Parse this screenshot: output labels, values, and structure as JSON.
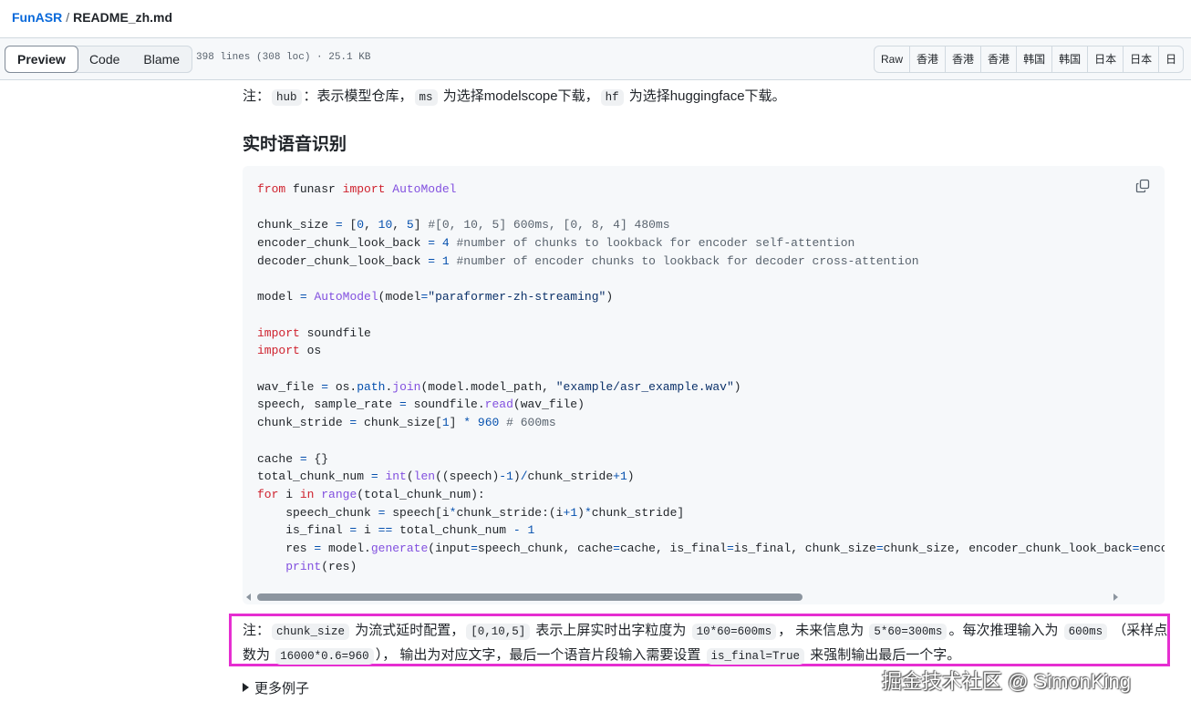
{
  "breadcrumb": {
    "repo": "FunASR",
    "separator": "/",
    "file": "README_zh.md"
  },
  "toolbar": {
    "tabs": [
      {
        "label": "Preview",
        "active": true
      },
      {
        "label": "Code",
        "active": false
      },
      {
        "label": "Blame",
        "active": false
      }
    ],
    "file_meta": "398 lines (308 loc) · 25.1 KB",
    "buttons": [
      "Raw",
      "香港",
      "香港",
      "香港",
      "韩国",
      "韩国",
      "日本",
      "日本",
      "日"
    ]
  },
  "note1": {
    "prefix": "注：",
    "hub_code": "hub",
    "text1": "：表示模型仓库，",
    "ms_code": "ms",
    "text2": " 为选择modelscope下载，",
    "hf_code": "hf",
    "text3": " 为选择huggingface下载。"
  },
  "section_title": "实时语音识别",
  "code_lines": [
    "from funasr import AutoModel",
    "",
    "chunk_size = [0, 10, 5] #[0, 10, 5] 600ms, [0, 8, 4] 480ms",
    "encoder_chunk_look_back = 4 #number of chunks to lookback for encoder self-attention",
    "decoder_chunk_look_back = 1 #number of encoder chunks to lookback for decoder cross-attention",
    "",
    "model = AutoModel(model=\"paraformer-zh-streaming\")",
    "",
    "import soundfile",
    "import os",
    "",
    "wav_file = os.path.join(model.model_path, \"example/asr_example.wav\")",
    "speech, sample_rate = soundfile.read(wav_file)",
    "chunk_stride = chunk_size[1] * 960 # 600ms",
    "",
    "cache = {}",
    "total_chunk_num = int(len((speech)-1)/chunk_stride+1)",
    "for i in range(total_chunk_num):",
    "    speech_chunk = speech[i*chunk_stride:(i+1)*chunk_stride]",
    "    is_final = i == total_chunk_num - 1",
    "    res = model.generate(input=speech_chunk, cache=cache, is_final=is_final, chunk_size=chunk_size, encoder_chunk_look_back=enco",
    "    print(res)"
  ],
  "code_scroll_fraction": 0.64,
  "note2": {
    "prefix": "注：",
    "c1": "chunk_size",
    "t1": " 为流式延时配置，",
    "c2": "[0,10,5]",
    "t2": " 表示上屏实时出字粒度为 ",
    "c3": "10*60=600ms",
    "t3": "， 未来信息为 ",
    "c4": "5*60=300ms",
    "t4": "。每次推理输入为 ",
    "c5": "600ms",
    "t5": " （采样点数为 ",
    "c6": "16000*0.6=960",
    "t6": "）， 输出为对应文字，最后一个语音片段输入需要设置 ",
    "c7": "is_final=True",
    "t7": " 来强制输出最后一个字。"
  },
  "more_examples": "更多例子",
  "watermark": "掘金技术社区 @ SimonKing",
  "colors": {
    "highlight_border": "#e62ed1",
    "link": "#0969da",
    "keyword": "#cf222e",
    "function": "#8250df"
  },
  "icons": {
    "copy": "copy-icon",
    "disclosure": "triangle-right-icon"
  }
}
